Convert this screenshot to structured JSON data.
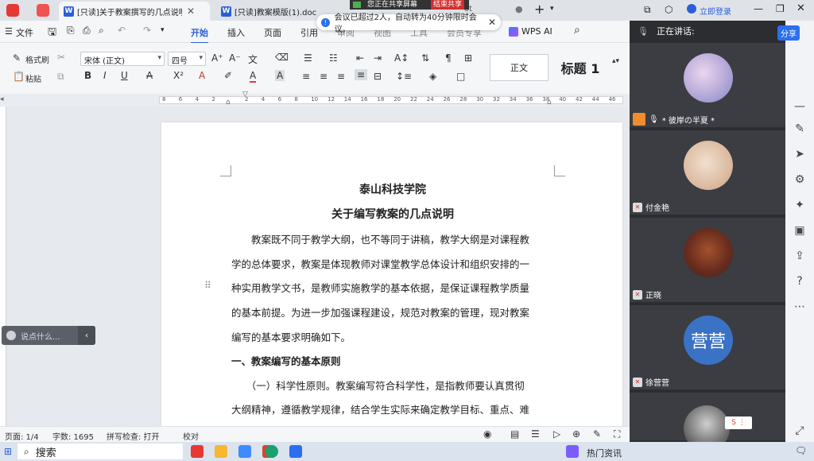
{
  "tabs": [
    {
      "label": "[只读]关于教案撰写的几点说明",
      "active": true
    },
    {
      "label": "[只读]教案模版(1).doc",
      "active": false
    }
  ],
  "share": {
    "text": "您正在共享屏幕",
    "stop": "结束共享",
    "tab_tail": "ot"
  },
  "toast": {
    "text": "会议已超过2人，自动转为40分钟限时会议。"
  },
  "topright": {
    "login": "立即登录"
  },
  "menu": {
    "file": "文件",
    "items": [
      "开始",
      "插入",
      "页面",
      "引用",
      "审阅",
      "视图",
      "工具",
      "会员专享"
    ],
    "wpsai": "WPS AI",
    "share": "分享"
  },
  "ribbon": {
    "format_painter": "格式刷",
    "paste": "粘贴",
    "font_name": "宋体 (正文)",
    "font_size": "四号",
    "style_normal": "正文",
    "style_heading": "标题 1"
  },
  "ruler": {
    "ticks": [
      "8",
      "6",
      "4",
      "2",
      "",
      "2",
      "4",
      "6",
      "8",
      "10",
      "12",
      "14",
      "16",
      "18",
      "20",
      "22",
      "24",
      "26",
      "28",
      "30",
      "32",
      "34",
      "36",
      "38",
      "40",
      "42",
      "44",
      "46"
    ]
  },
  "document": {
    "title1": "泰山科技学院",
    "title2": "关于编写教案的几点说明",
    "lines": [
      "　　教案既不同于教学大纲，也不等同于讲稿，教学大纲是对课程教",
      "学的总体要求，教案是体现教师对课堂教学总体设计和组织安排的一",
      "种实用教学文书，是教师实施教学的基本依据，是保证课程教学质量",
      "的基本前提。为进一步加强课程建设，规范对教案的管理，现对教案",
      "编写的基本要求明确如下。"
    ],
    "heading1": "一、教案编写的基本原则",
    "lines2": [
      "　　（一）科学性原则。教案编写符合科学性，是指教师要认真贯彻",
      "大纲精神，遵循教学规律，结合学生实际来确定教学目标、重点、难"
    ]
  },
  "sayit": {
    "placeholder": "说点什么..."
  },
  "status": {
    "page": "页面: 1/4",
    "words": "字数: 1695",
    "spell": "拼写检查: 打开",
    "proof": "校对"
  },
  "taskbar": {
    "search": "搜索",
    "news": "热门资讯"
  },
  "meeting": {
    "speaking": "正在讲话:",
    "participants": [
      {
        "name": "* 彼岸の半夏 *",
        "initials": ""
      },
      {
        "name": "付金艳",
        "initials": ""
      },
      {
        "name": "正晓",
        "initials": ""
      },
      {
        "name": "徐营营",
        "initials": "营营"
      },
      {
        "name": "",
        "initials": ""
      }
    ]
  }
}
